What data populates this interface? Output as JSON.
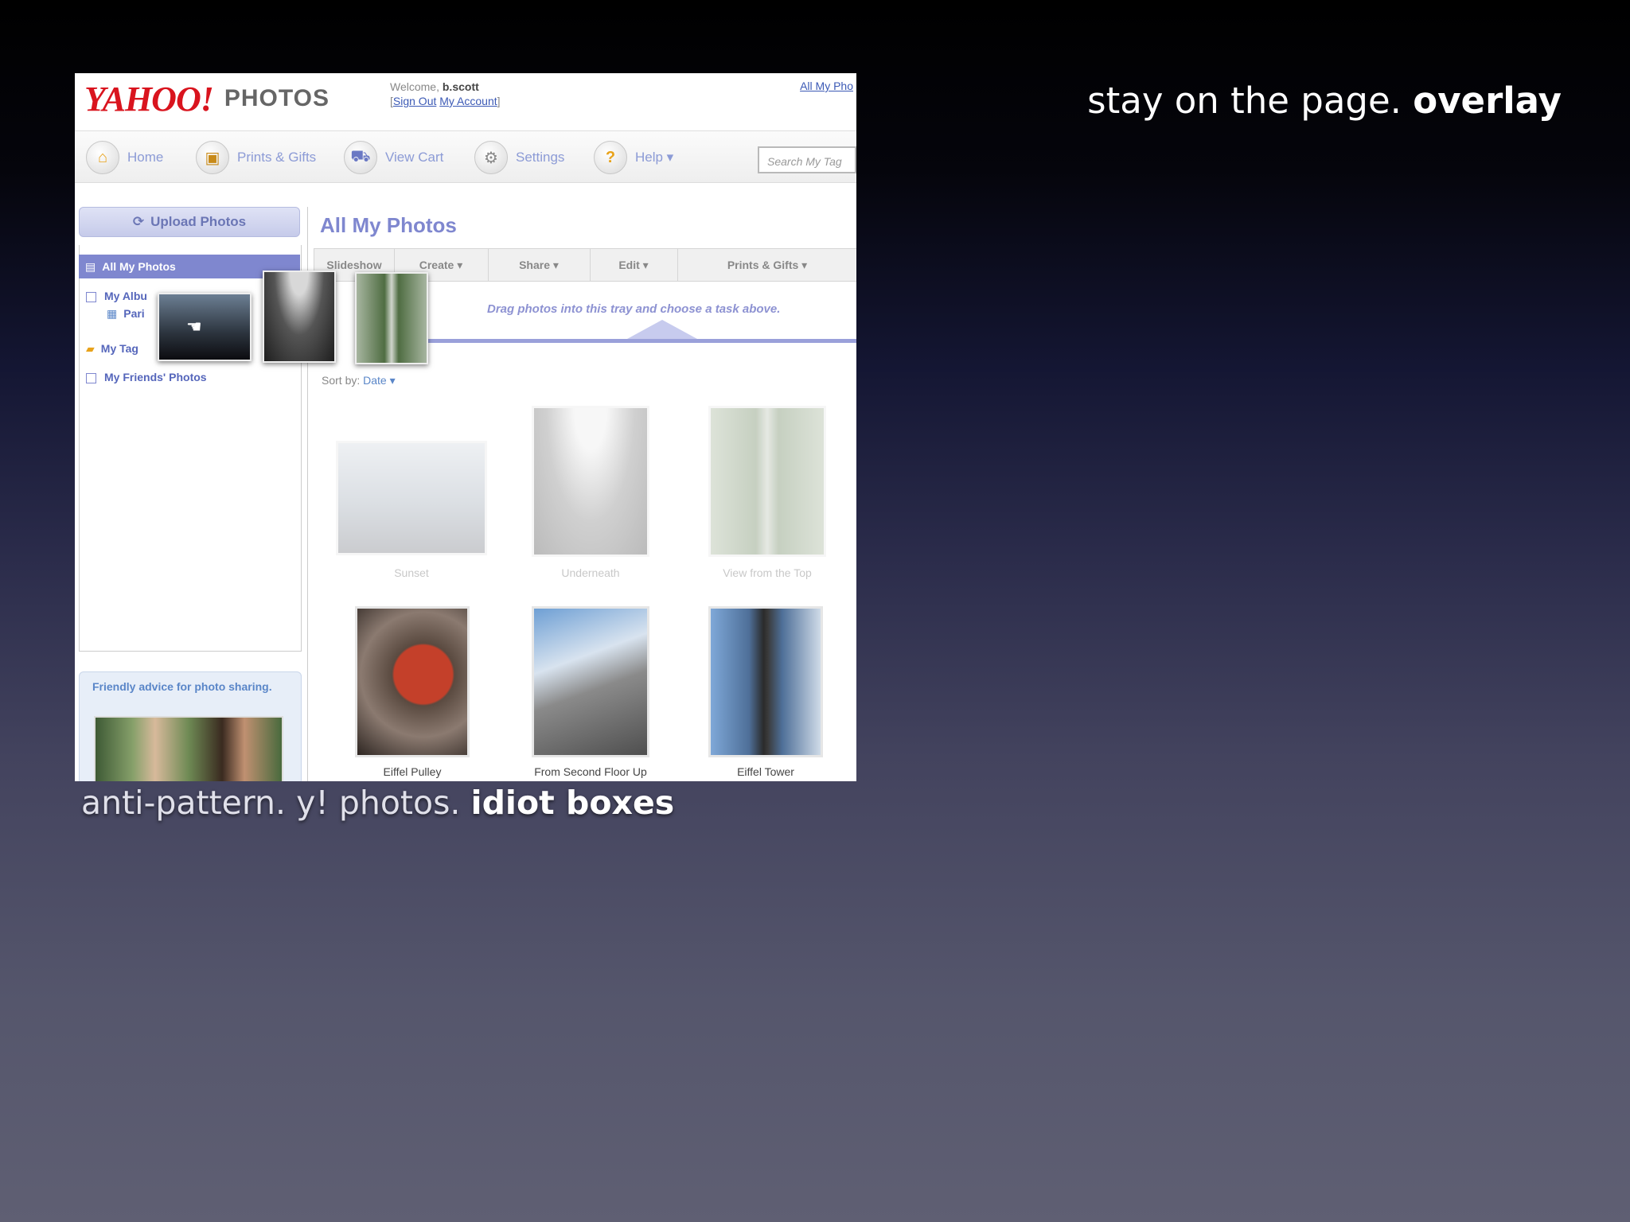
{
  "slide": {
    "title_plain": "stay on the page.",
    "title_bold": "overlay",
    "caption_plain": "anti-pattern. y! photos.",
    "caption_bold": "idiot boxes"
  },
  "app": {
    "logo_text": "YAHOO!",
    "logo_subtitle": "PHOTOS",
    "welcome_label": "Welcome,",
    "username": "b.scott",
    "sign_out": "Sign Out",
    "my_account": "My Account",
    "top_link": "All My Pho"
  },
  "nav": {
    "items": [
      {
        "label": "Home",
        "icon": "home-icon",
        "glyph": "⌂"
      },
      {
        "label": "Prints & Gifts",
        "icon": "gift-icon",
        "glyph": "▣"
      },
      {
        "label": "View Cart",
        "icon": "cart-icon",
        "glyph": "⛟"
      },
      {
        "label": "Settings",
        "icon": "wrench-icon",
        "glyph": "⚙"
      },
      {
        "label": "Help ▾",
        "icon": "help-icon",
        "glyph": "?"
      }
    ],
    "search_placeholder": "Search My Tag"
  },
  "sidebar": {
    "upload_label": "Upload Photos",
    "selected_item": "All My Photos",
    "items": [
      "My Albu",
      "Pari",
      "My Tag",
      "My Friends' Photos"
    ],
    "advice_text": "Friendly advice for photo sharing."
  },
  "main": {
    "title": "All My Photos",
    "tabs": [
      "Slideshow",
      "Create ▾",
      "Share ▾",
      "Edit ▾",
      "Prints & Gifts ▾"
    ],
    "tray_hint": "Drag photos into this tray and choose a task above.",
    "sort_label": "Sort by:",
    "sort_value": "Date ▾",
    "photos": [
      {
        "label": "Sunset",
        "faded": true
      },
      {
        "label": "Underneath",
        "faded": true
      },
      {
        "label": "View from the Top",
        "faded": true
      },
      {
        "label": "Eiffel Pulley",
        "faded": false
      },
      {
        "label": "From Second Floor Up",
        "faded": false
      },
      {
        "label": "Eiffel Tower",
        "faded": false
      }
    ]
  }
}
